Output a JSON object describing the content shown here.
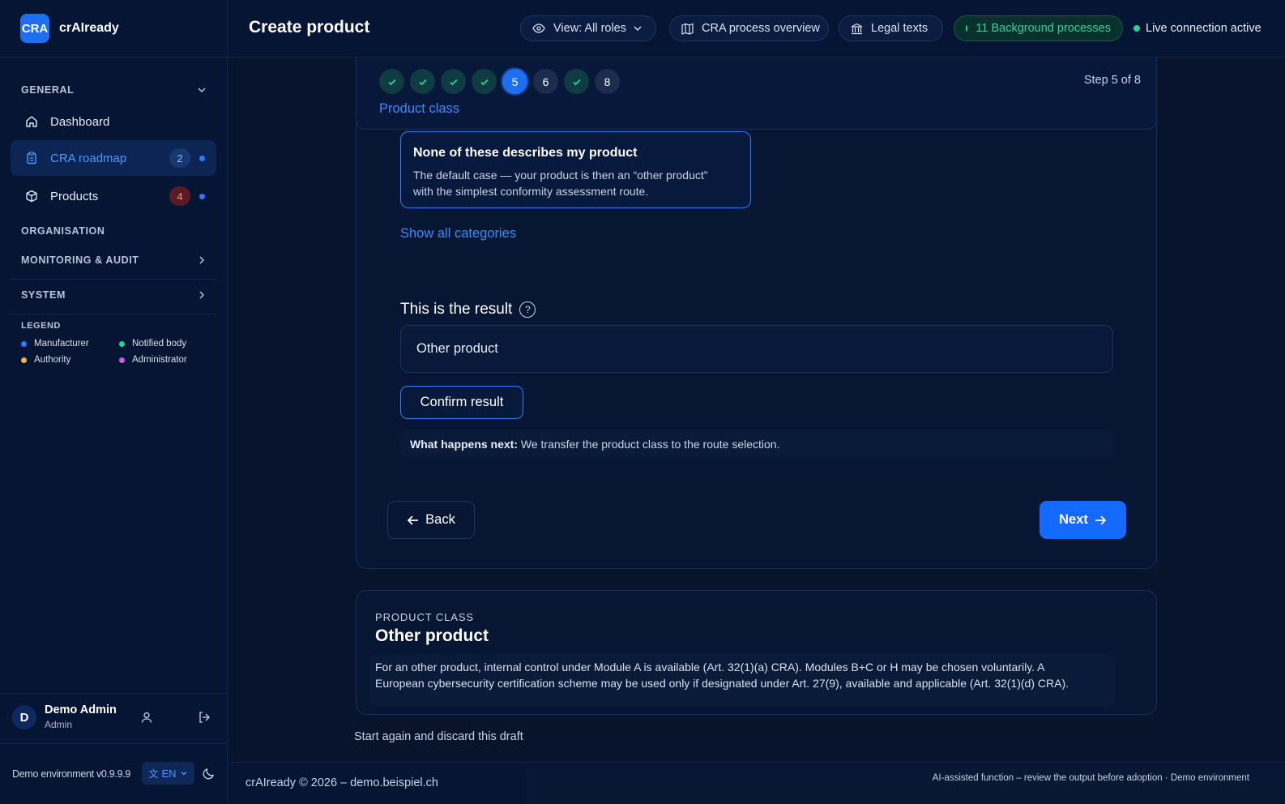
{
  "brand": {
    "logo_text": "CRA",
    "name": "crAIready"
  },
  "sidebar": {
    "general_label": "GENERAL",
    "items": [
      {
        "label": "Dashboard"
      },
      {
        "label": "CRA roadmap",
        "badge": "2"
      },
      {
        "label": "Products",
        "badge": "4"
      }
    ],
    "organisation_label": "ORGANISATION",
    "monitoring_label": "MONITORING & AUDIT",
    "system_label": "SYSTEM",
    "legend": {
      "title": "LEGEND",
      "items": [
        {
          "label": "Manufacturer",
          "color": "#2b7bff"
        },
        {
          "label": "Notified body",
          "color": "#22d3a4"
        },
        {
          "label": "Authority",
          "color": "#f5b82e"
        },
        {
          "label": "Administrator",
          "color": "#c65cf0"
        }
      ]
    },
    "user": {
      "initial": "D",
      "name": "Demo Admin",
      "role": "Admin"
    },
    "env_text": "Demo environment v0.9.9.9",
    "lang": "EN"
  },
  "topbar": {
    "title": "Create product",
    "view_label": "View: All roles",
    "process_label": "CRA process overview",
    "legal_label": "Legal texts",
    "background_label": "11 Background processes",
    "live_label": "Live connection active"
  },
  "stepper": {
    "steps": [
      "",
      "",
      "",
      "",
      "5",
      "6",
      "",
      "8"
    ],
    "step_text": "Step 5 of 8",
    "current_title": "Product class"
  },
  "option": {
    "title": "None of these describes my product",
    "description_line1": "The default case — your product is then an “other product”",
    "description_line2": "with the simplest conformity assessment route."
  },
  "show_all_label": "Show all categories",
  "result": {
    "heading": "This is the result",
    "value": "Other product",
    "confirm_label": "Confirm result",
    "next_bold": "What happens next:",
    "next_text": " We transfer the product class to the route selection."
  },
  "nav": {
    "back_label": "Back",
    "next_label": "Next"
  },
  "summary": {
    "kicker": "PRODUCT CLASS",
    "title": "Other product",
    "line1": "For an other product, internal control under Module A is available (Art. 32(1)(a) CRA). Modules B+C or H may be chosen voluntarily. A",
    "line2": "European cybersecurity certification scheme may be used only if designated under Art. 27(9), available and applicable (Art. 32(1)(d) CRA)."
  },
  "discard_label": "Start again and discard this draft",
  "footer": {
    "copyright": "crAIready © 2026 – demo.beispiel.ch",
    "notice": "AI-assisted function – review the output before adoption · Demo environment"
  }
}
